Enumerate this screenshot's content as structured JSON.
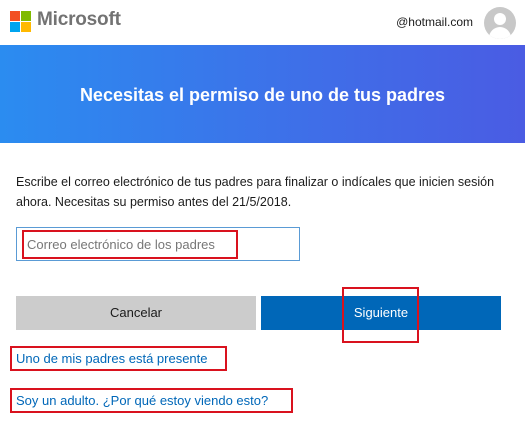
{
  "header": {
    "brand": "Microsoft",
    "account_email": "@hotmail.com",
    "logo_colors": [
      "#f25022",
      "#7fba00",
      "#00a4ef",
      "#ffb900"
    ]
  },
  "banner": {
    "title": "Necesitas el permiso de uno de tus padres",
    "gradient": [
      "#2b8cf0",
      "#4a5ce3"
    ]
  },
  "main": {
    "description": "Escribe el correo electrónico de tus padres para finalizar o indícales que inicien sesión ahora. Necesitas su permiso antes del 21/5/2018.",
    "email_input": {
      "value": "",
      "placeholder": "Correo electrónico de los padres"
    },
    "cancel_label": "Cancelar",
    "next_label": "Siguiente",
    "parent_present_link": "Uno de mis padres está presente",
    "adult_link": "Soy un adulto. ¿Por qué estoy viendo esto?"
  },
  "colors": {
    "primary": "#0067b8",
    "secondary_button": "#cccccc",
    "highlight": "#d9121e"
  }
}
